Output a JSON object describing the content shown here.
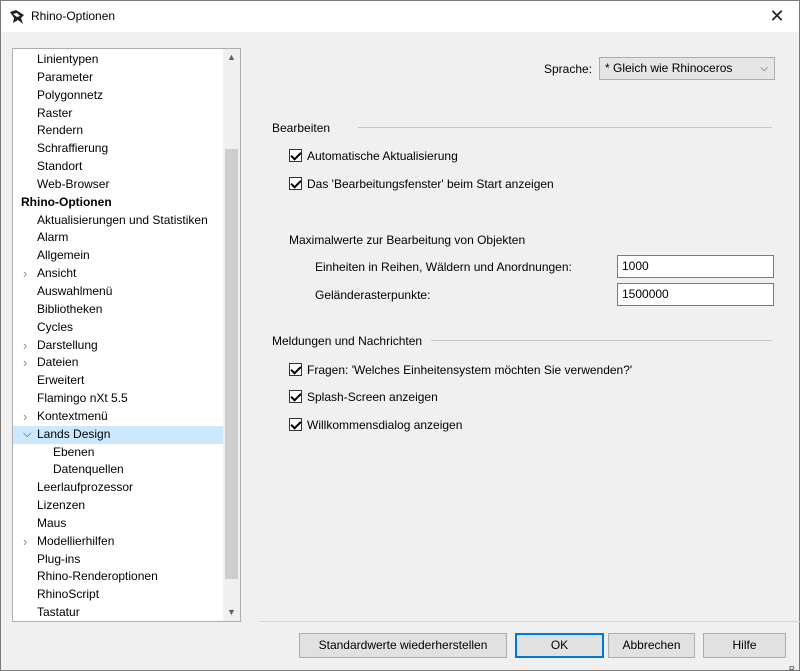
{
  "window": {
    "title": "Rhino-Optionen",
    "close_glyph": "✕"
  },
  "tree": {
    "items": [
      {
        "label": "Linientypen",
        "level": 1,
        "expandable": false,
        "selected": false,
        "bold": false
      },
      {
        "label": "Parameter",
        "level": 1,
        "expandable": false,
        "selected": false,
        "bold": false
      },
      {
        "label": "Polygonnetz",
        "level": 1,
        "expandable": false,
        "selected": false,
        "bold": false
      },
      {
        "label": "Raster",
        "level": 1,
        "expandable": false,
        "selected": false,
        "bold": false
      },
      {
        "label": "Rendern",
        "level": 1,
        "expandable": false,
        "selected": false,
        "bold": false
      },
      {
        "label": "Schraffierung",
        "level": 1,
        "expandable": false,
        "selected": false,
        "bold": false
      },
      {
        "label": "Standort",
        "level": 1,
        "expandable": false,
        "selected": false,
        "bold": false
      },
      {
        "label": "Web-Browser",
        "level": 1,
        "expandable": false,
        "selected": false,
        "bold": false
      },
      {
        "label": "Rhino-Optionen",
        "level": 0,
        "expandable": false,
        "selected": false,
        "bold": true
      },
      {
        "label": "Aktualisierungen und Statistiken",
        "level": 1,
        "expandable": false,
        "selected": false,
        "bold": false
      },
      {
        "label": "Alarm",
        "level": 1,
        "expandable": false,
        "selected": false,
        "bold": false
      },
      {
        "label": "Allgemein",
        "level": 1,
        "expandable": false,
        "selected": false,
        "bold": false
      },
      {
        "label": "Ansicht",
        "level": 1,
        "expandable": true,
        "expanded": false,
        "selected": false,
        "bold": false
      },
      {
        "label": "Auswahlmenü",
        "level": 1,
        "expandable": false,
        "selected": false,
        "bold": false
      },
      {
        "label": "Bibliotheken",
        "level": 1,
        "expandable": false,
        "selected": false,
        "bold": false
      },
      {
        "label": "Cycles",
        "level": 1,
        "expandable": false,
        "selected": false,
        "bold": false
      },
      {
        "label": "Darstellung",
        "level": 1,
        "expandable": true,
        "expanded": false,
        "selected": false,
        "bold": false
      },
      {
        "label": "Dateien",
        "level": 1,
        "expandable": true,
        "expanded": false,
        "selected": false,
        "bold": false
      },
      {
        "label": "Erweitert",
        "level": 1,
        "expandable": false,
        "selected": false,
        "bold": false
      },
      {
        "label": "Flamingo nXt 5.5",
        "level": 1,
        "expandable": false,
        "selected": false,
        "bold": false
      },
      {
        "label": "Kontextmenü",
        "level": 1,
        "expandable": true,
        "expanded": false,
        "selected": false,
        "bold": false
      },
      {
        "label": "Lands Design",
        "level": 1,
        "expandable": true,
        "expanded": true,
        "selected": true,
        "bold": false
      },
      {
        "label": "Ebenen",
        "level": 2,
        "expandable": false,
        "selected": false,
        "bold": false
      },
      {
        "label": "Datenquellen",
        "level": 2,
        "expandable": false,
        "selected": false,
        "bold": false
      },
      {
        "label": "Leerlaufprozessor",
        "level": 1,
        "expandable": false,
        "selected": false,
        "bold": false
      },
      {
        "label": "Lizenzen",
        "level": 1,
        "expandable": false,
        "selected": false,
        "bold": false
      },
      {
        "label": "Maus",
        "level": 1,
        "expandable": false,
        "selected": false,
        "bold": false
      },
      {
        "label": "Modellierhilfen",
        "level": 1,
        "expandable": true,
        "expanded": false,
        "selected": false,
        "bold": false
      },
      {
        "label": "Plug-ins",
        "level": 1,
        "expandable": false,
        "selected": false,
        "bold": false
      },
      {
        "label": "Rhino-Renderoptionen",
        "level": 1,
        "expandable": false,
        "selected": false,
        "bold": false
      },
      {
        "label": "RhinoScript",
        "level": 1,
        "expandable": false,
        "selected": false,
        "bold": false
      },
      {
        "label": "Tastatur",
        "level": 1,
        "expandable": false,
        "selected": false,
        "bold": false
      }
    ]
  },
  "language": {
    "label": "Sprache:",
    "value": "* Gleich wie Rhinoceros"
  },
  "editing": {
    "title": "Bearbeiten",
    "auto_update": {
      "label": "Automatische Aktualisierung",
      "checked": true
    },
    "show_window": {
      "label": "Das 'Bearbeitungsfenster' beim Start anzeigen",
      "checked": true
    },
    "max_title": "Maximalwerte zur Bearbeitung von Objekten",
    "units_label": "Einheiten in Reihen, Wäldern und Anordnungen:",
    "units_value": "1000",
    "railing_label": "Geländerasterpunkte:",
    "railing_value": "1500000"
  },
  "messages": {
    "title": "Meldungen und Nachrichten",
    "ask_units": {
      "label": "Fragen: 'Welches Einheitensystem möchten Sie verwenden?'",
      "checked": true
    },
    "splash": {
      "label": "Splash-Screen anzeigen",
      "checked": true
    },
    "welcome": {
      "label": "Willkommensdialog anzeigen",
      "checked": true
    }
  },
  "buttons": {
    "restore": "Standardwerte wiederherstellen",
    "ok": "OK",
    "cancel": "Abbrechen",
    "help": "Hilfe"
  },
  "resize_tag": "R"
}
